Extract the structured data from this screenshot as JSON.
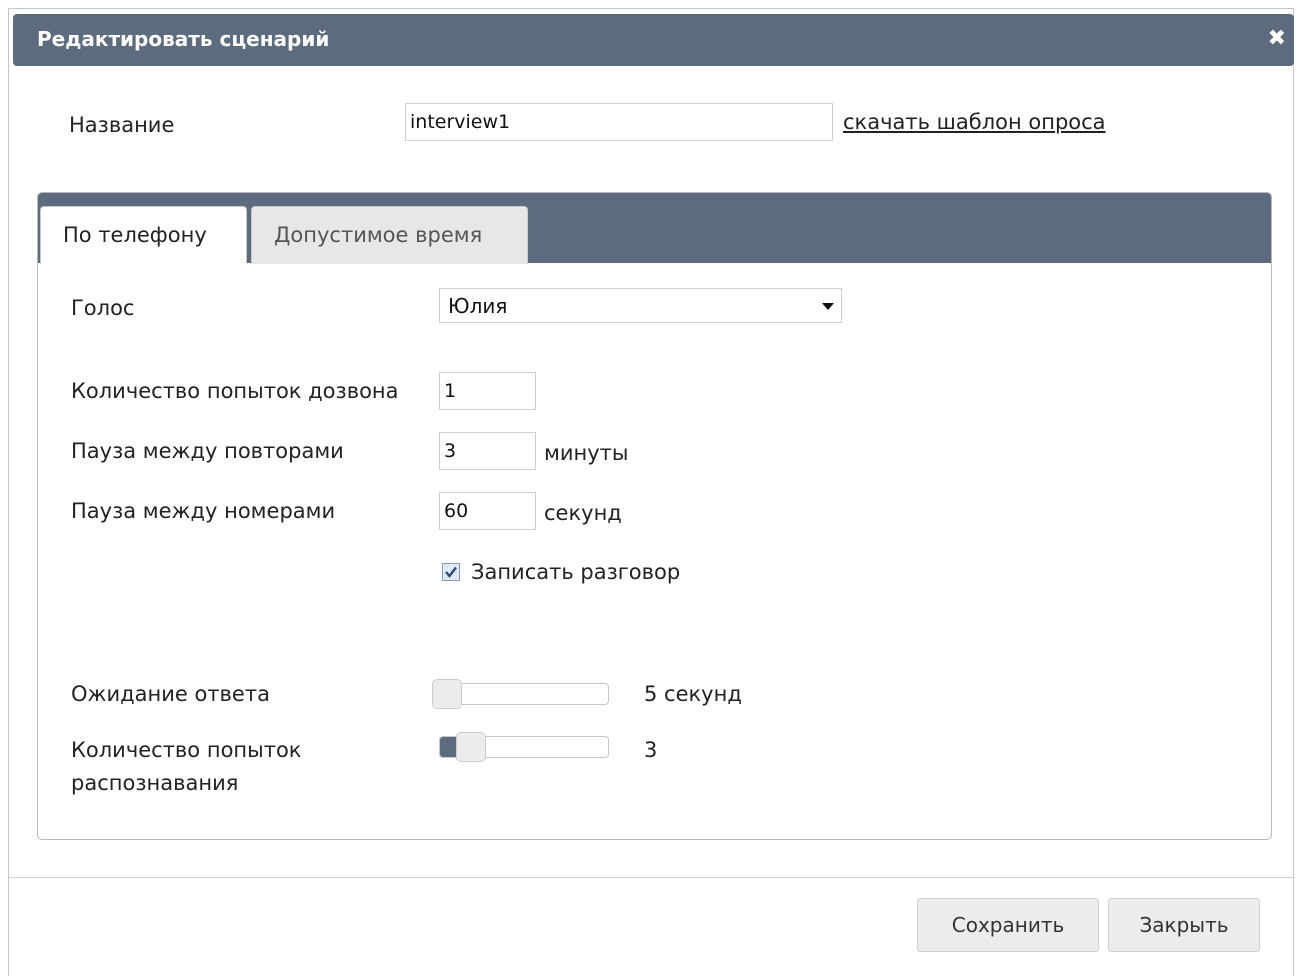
{
  "dialog": {
    "title": "Редактировать сценарий",
    "close_symbol": "✖"
  },
  "name_row": {
    "label": "Название",
    "value": "interview1",
    "template_link": "скачать шаблон опроса"
  },
  "tabs": [
    {
      "label": "По телефону",
      "active": true
    },
    {
      "label": "Допустимое время",
      "active": false
    }
  ],
  "phone_tab": {
    "voice": {
      "label": "Голос",
      "selected": "Юлия"
    },
    "dial_attempts": {
      "label": "Количество попыток дозвона",
      "value": "1"
    },
    "retry_pause": {
      "label": "Пауза между повторами",
      "value": "3",
      "unit": "минуты"
    },
    "number_pause": {
      "label": "Пауза между номерами",
      "value": "60",
      "unit": "секунд"
    },
    "record_call": {
      "label": "Записать разговор",
      "checked": true
    },
    "answer_wait": {
      "label": "Ожидание ответа",
      "display": "5 секунд",
      "level": 0.0
    },
    "recognition_attempts": {
      "label_line1": "Количество попыток",
      "label_line2": "распознавания",
      "display": "3",
      "level": 0.12
    }
  },
  "footer": {
    "save_label": "Сохранить",
    "close_label": "Закрыть"
  },
  "colors": {
    "header_bg": "#5c6b7e",
    "button_bg": "#ececec"
  }
}
